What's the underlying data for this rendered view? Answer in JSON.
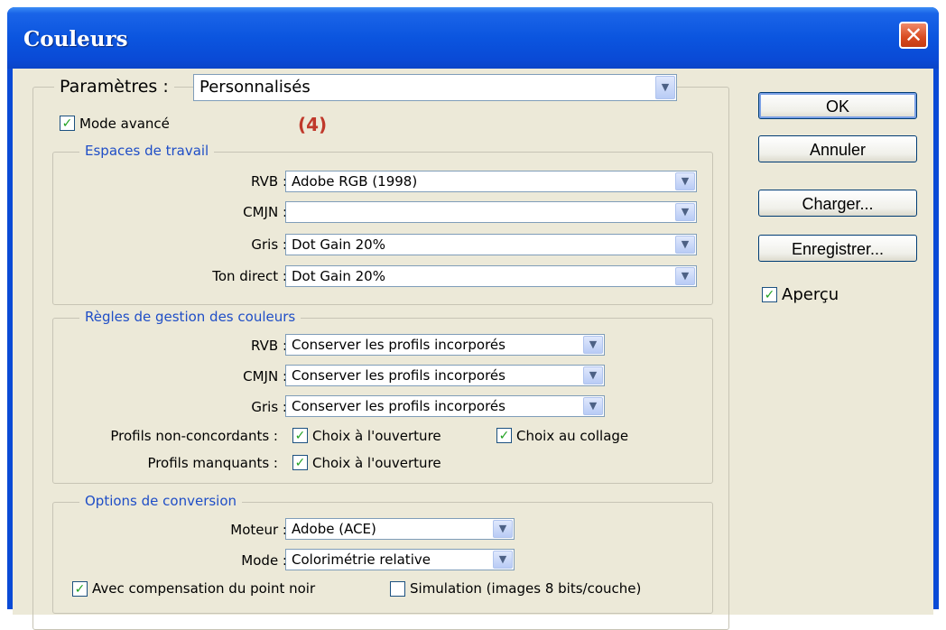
{
  "window": {
    "title": "Couleurs"
  },
  "settings": {
    "label": "Paramètres :",
    "value": "Personnalisés"
  },
  "advanced_mode": {
    "label": "Mode avancé",
    "checked": true
  },
  "annotation": "(4)",
  "working_spaces": {
    "legend": "Espaces de travail",
    "rows": [
      {
        "label": "RVB :",
        "value": "Adobe RGB (1998)"
      },
      {
        "label": "CMJN :",
        "value": ""
      },
      {
        "label": "Gris :",
        "value": "Dot Gain 20%"
      },
      {
        "label": "Ton direct :",
        "value": "Dot Gain 20%"
      }
    ]
  },
  "color_policies": {
    "legend": "Règles de gestion des couleurs",
    "rows": [
      {
        "label": "RVB :",
        "value": "Conserver les profils incorporés"
      },
      {
        "label": "CMJN :",
        "value": "Conserver les profils incorporés"
      },
      {
        "label": "Gris :",
        "value": "Conserver les profils incorporés"
      }
    ],
    "mismatch": {
      "label": "Profils non-concordants :",
      "open": "Choix à l'ouverture",
      "paste": "Choix au collage"
    },
    "missing": {
      "label": "Profils manquants :",
      "open": "Choix à l'ouverture"
    }
  },
  "conversion": {
    "legend": "Options de conversion",
    "engine": {
      "label": "Moteur :",
      "value": "Adobe (ACE)"
    },
    "intent": {
      "label": "Mode :",
      "value": "Colorimétrie relative"
    },
    "black_point": "Avec compensation du point noir",
    "simulation": "Simulation (images 8 bits/couche)"
  },
  "buttons": {
    "ok": "OK",
    "cancel": "Annuler",
    "load": "Charger...",
    "save": "Enregistrer..."
  },
  "preview": {
    "label": "Aperçu",
    "checked": true
  },
  "icons": {
    "check": "check-icon",
    "dropdown": "chevron-down-icon",
    "close": "close-icon"
  }
}
